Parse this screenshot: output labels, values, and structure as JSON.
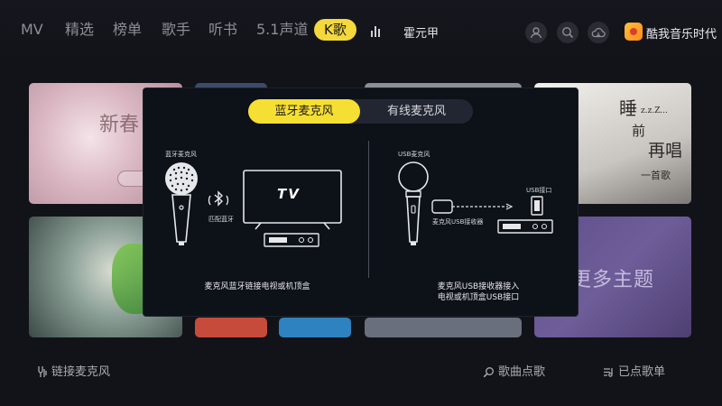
{
  "nav": {
    "tabs": [
      "MV",
      "精选",
      "榜单",
      "歌手",
      "听书",
      "5.1声道",
      "K歌"
    ],
    "active_tab": "K歌",
    "user_name": "霍元甲",
    "brand_name": "酷我音乐时代"
  },
  "cards": {
    "card1_text": "新春",
    "card5_vertical": [
      "睡",
      "前",
      "再唱"
    ],
    "card5_sub": "一首歌",
    "card5_zz": "z.z.Z...",
    "card6_text": "更多主题"
  },
  "bottom_bar": {
    "connect_mic": "链接麦克风",
    "search_song": "歌曲点歌",
    "queued_songs": "已点歌单"
  },
  "dialog": {
    "tab_bluetooth": "蓝牙麦克风",
    "tab_wired": "有线麦克风",
    "active_tab": "蓝牙麦克风",
    "left": {
      "mic_label": "蓝牙麦克风",
      "pair_label": "匹配蓝牙",
      "tv_text": "TV",
      "caption": "麦克风蓝牙链接电视或机顶盒"
    },
    "right": {
      "mic_label": "USB麦克风",
      "receiver_label": "麦克风USB接收器",
      "port_label": "USB接口",
      "caption_line1": "麦克风USB接收器接入",
      "caption_line2": "电视或机顶盒USB接口"
    }
  },
  "colors": {
    "background": "#121319",
    "accent_yellow": "#f6df33",
    "dialog_bg": "#0d1118",
    "segment_bg": "#222632"
  },
  "icons": [
    "bars-icon",
    "user-icon",
    "search-icon",
    "cloud-icon",
    "kuwo-logo-icon",
    "microphone-connect-icon",
    "song-search-icon",
    "playlist-icon",
    "bluetooth-icon"
  ]
}
